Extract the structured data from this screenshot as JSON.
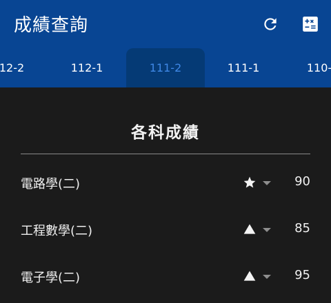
{
  "appbar": {
    "title": "成績查詢",
    "icons": {
      "refresh": "refresh-icon",
      "calculator": "calculator-icon"
    }
  },
  "tabs": [
    {
      "label": "12-2"
    },
    {
      "label": "112-1"
    },
    {
      "label": "111-2",
      "selected": true
    },
    {
      "label": "111-1"
    },
    {
      "label": "110-"
    }
  ],
  "section": {
    "title": "各科成績",
    "courses": [
      {
        "name": "電路學(二)",
        "icon": "star-icon",
        "score": "90"
      },
      {
        "name": "工程數學(二)",
        "icon": "triangle-up-icon",
        "score": "85"
      },
      {
        "name": "電子學(二)",
        "icon": "triangle-up-icon",
        "score": "95"
      }
    ]
  },
  "colors": {
    "primary": "#084593",
    "active_tab_bg": "#053a75",
    "active_tab_text": "#3f88e6",
    "background": "#1b1b1b"
  }
}
